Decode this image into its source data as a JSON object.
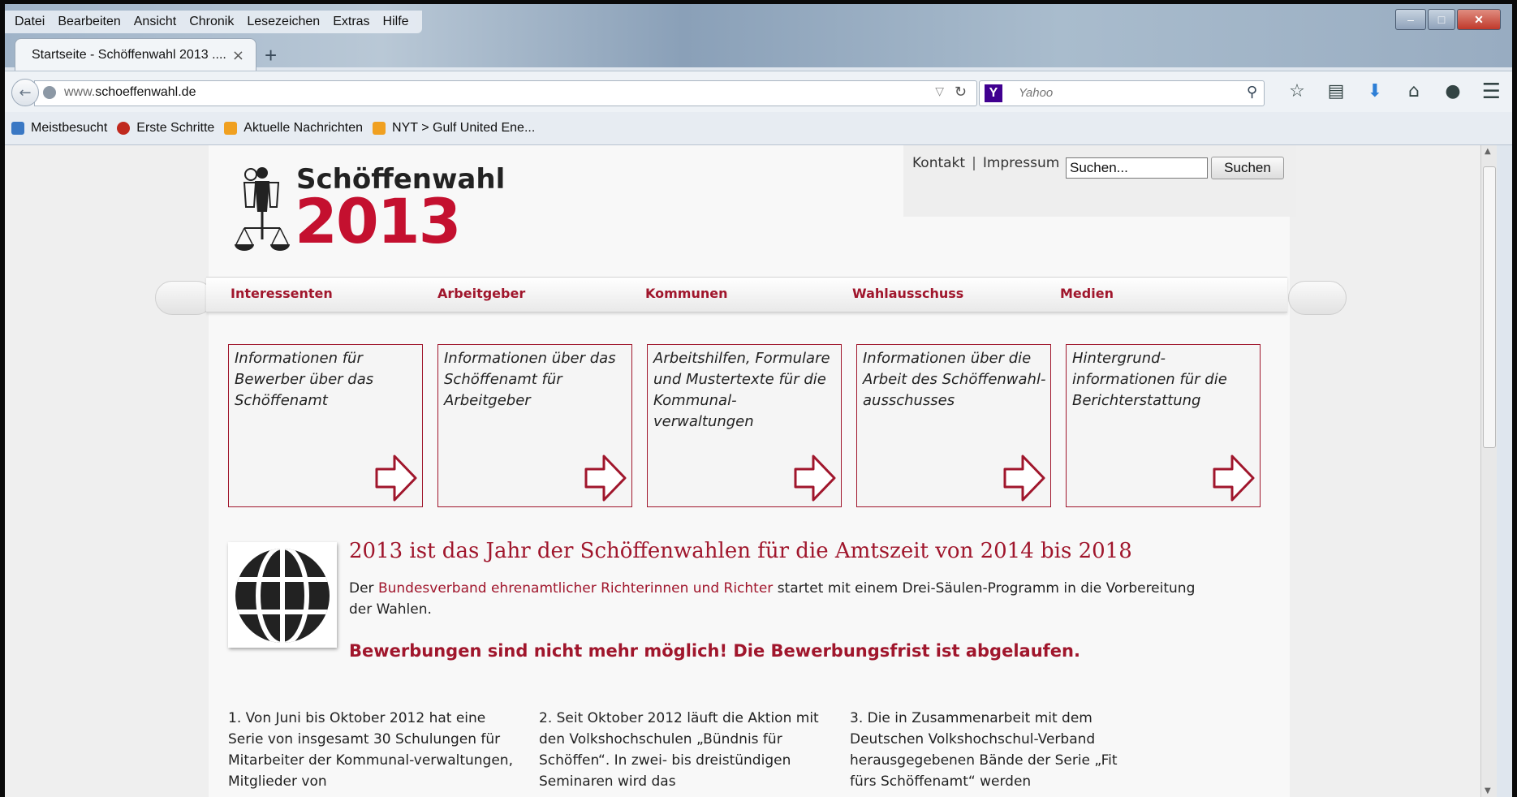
{
  "browser": {
    "menu": [
      "Datei",
      "Bearbeiten",
      "Ansicht",
      "Chronik",
      "Lesezeichen",
      "Extras",
      "Hilfe"
    ],
    "tab_title": "Startseite - Schöffenwahl 2013 ....",
    "tab_close": "×",
    "new_tab": "+",
    "url_prefix": "www.",
    "url_domain": "schoeffenwahl.de",
    "search_engine": "Y",
    "search_placeholder": "Yahoo",
    "bookmarks": [
      "Meistbesucht",
      "Erste Schritte",
      "Aktuelle Nachrichten",
      "NYT > Gulf United Ene..."
    ]
  },
  "site": {
    "top_links": [
      "Kontakt",
      "Impressum"
    ],
    "search_value": "Suchen...",
    "search_button": "Suchen",
    "logo_line1": "Schöffenwahl",
    "logo_line2": "2013",
    "nav": [
      "Interessenten",
      "Arbeitgeber",
      "Kommunen",
      "Wahlausschuss",
      "Medien"
    ],
    "cards": [
      "Informationen für Bewerber über das Schöffenamt",
      "Informationen über das Schöffenamt für Arbeitgeber",
      "Arbeitshilfen, Formulare und Mustertexte für die Kommunal- verwaltungen",
      "Informationen über die Arbeit des Schöffenwahl- ausschusses",
      "Hintergrund- informationen für die Berichterstattung"
    ],
    "headline": "2013 ist das Jahr der Schöffenwahlen für die Amtszeit von 2014 bis 2018",
    "intro_pre": "Der ",
    "intro_link": "Bundesverband ehrenamtlicher Richterinnen und Richter",
    "intro_post": " startet mit einem Drei-Säulen-Programm in die Vorbereitung der Wahlen.",
    "alert": "Bewerbungen sind nicht mehr möglich! Die Bewerbungsfrist ist abgelaufen.",
    "columns": [
      "1. Von Juni bis Oktober 2012 hat eine Serie von insgesamt 30 Schulungen für Mitarbeiter der Kommunal-verwaltungen, Mitglieder von",
      "2. Seit Oktober 2012 läuft die Aktion mit den Volkshochschulen „Bündnis für Schöffen“. In zwei- bis dreistündigen Seminaren wird das",
      "3. Die in Zusammenarbeit mit dem Deutschen Volkshochschul-Verband herausgegebenen Bände der Serie „Fit fürs Schöffenamt“ werden"
    ]
  },
  "colors": {
    "accent": "#a0162c",
    "logo_red": "#c4102f"
  }
}
